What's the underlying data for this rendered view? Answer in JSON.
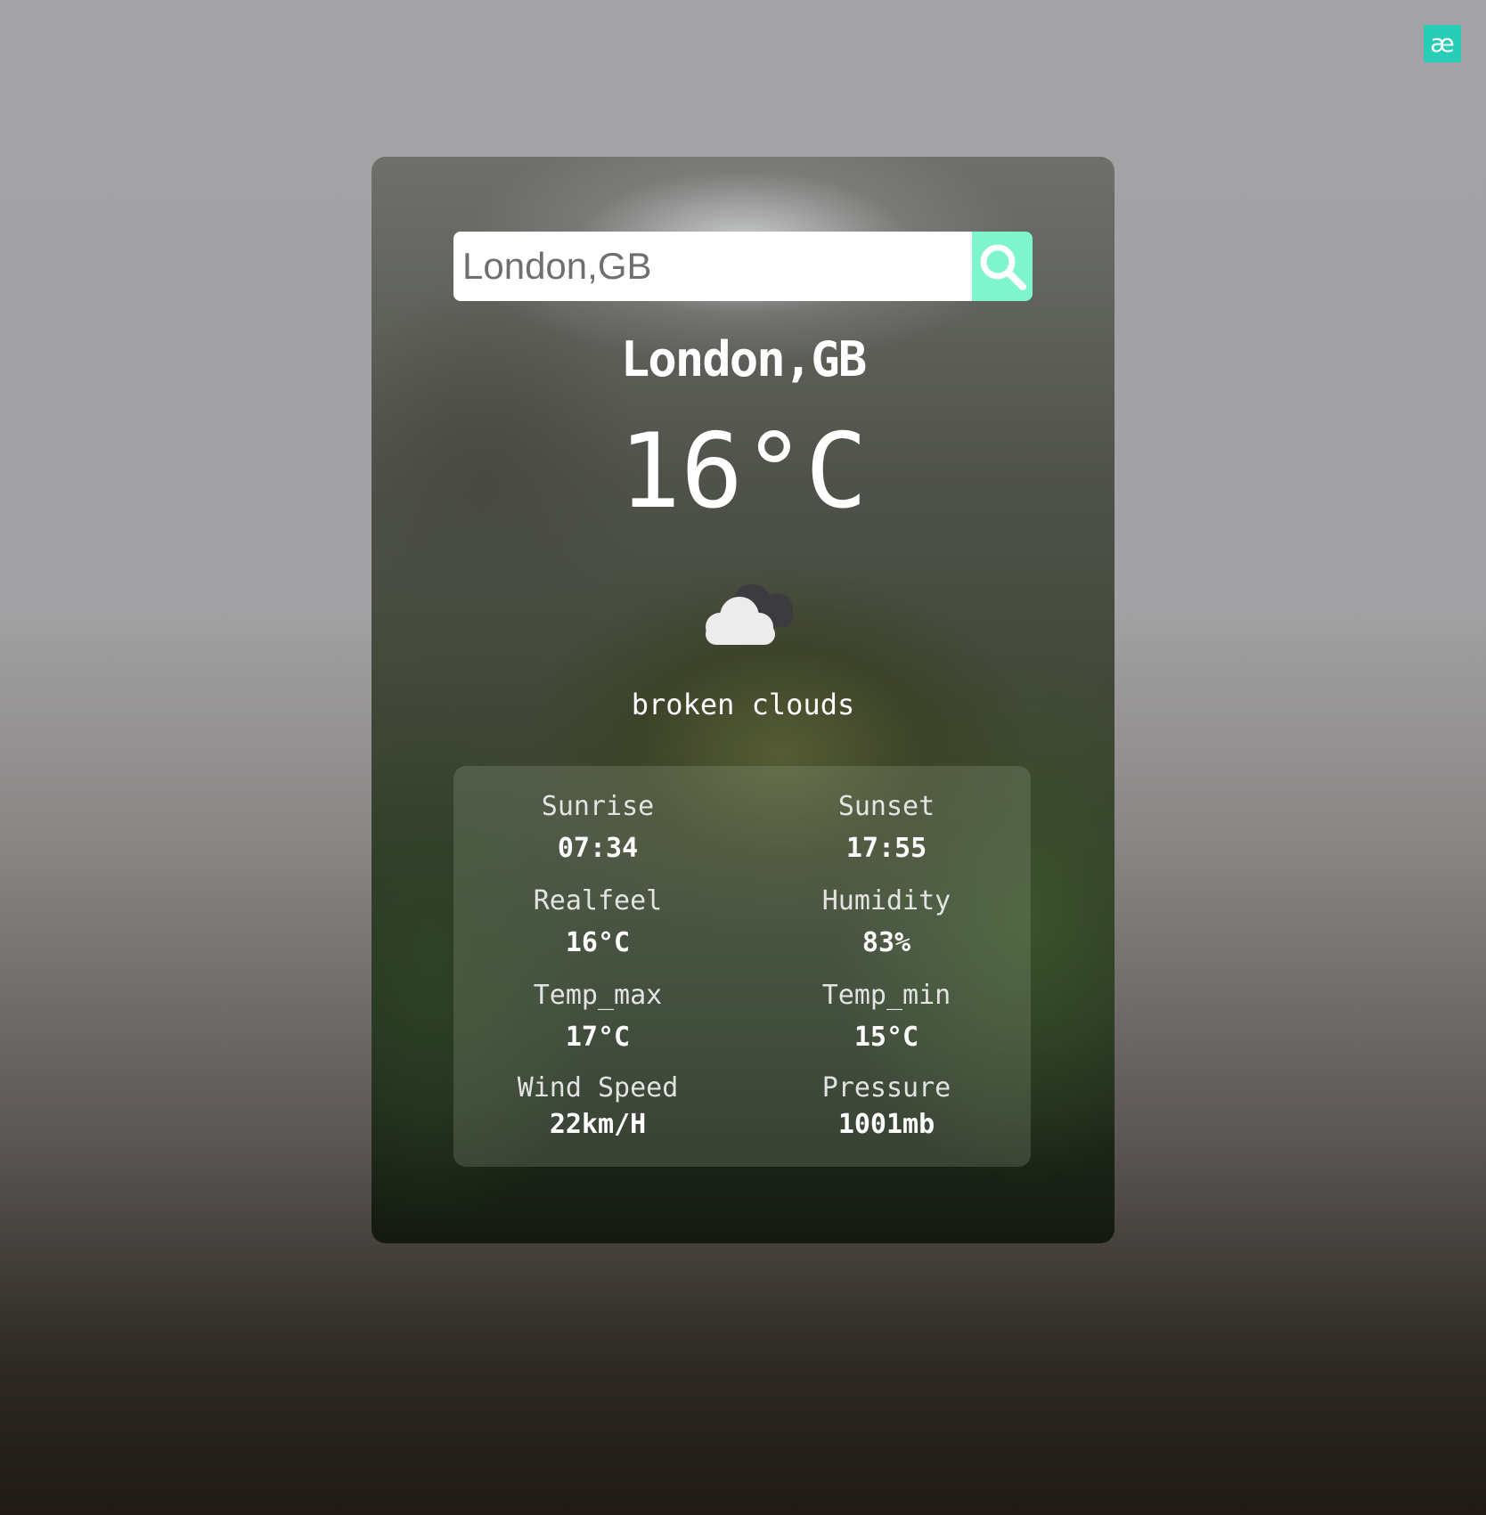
{
  "brand": {
    "glyph": "æ"
  },
  "search": {
    "value": "London,GB",
    "button_icon": "search-icon",
    "accent_color": "#7ef5cc"
  },
  "weather": {
    "city": "London,GB",
    "temperature": "16°C",
    "condition": "broken clouds",
    "condition_icon": "broken-clouds-icon"
  },
  "details": [
    {
      "label": "Sunrise",
      "value": "07:34"
    },
    {
      "label": "Sunset",
      "value": "17:55"
    },
    {
      "label": "Realfeel",
      "value": "16°C"
    },
    {
      "label": "Humidity",
      "value": "83%"
    },
    {
      "label": "Temp_max",
      "value": "17°C"
    },
    {
      "label": "Temp_min",
      "value": "15°C"
    },
    {
      "label": "Wind Speed",
      "value": "22km/H"
    },
    {
      "label": "Pressure",
      "value": "1001mb"
    }
  ]
}
